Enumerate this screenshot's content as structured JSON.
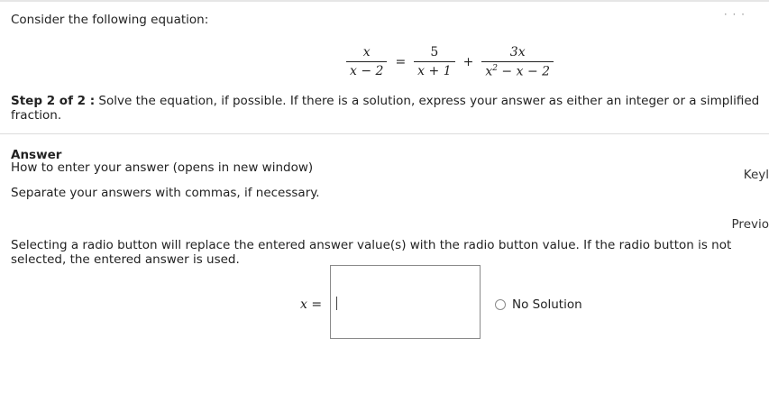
{
  "question": {
    "prompt": "Consider the following equation:",
    "equation": {
      "term1_num": "x",
      "term1_den": "x − 2",
      "equals": "=",
      "term2_num": "5",
      "term2_den": "x + 1",
      "plus": "+",
      "term3_num": "3x",
      "term3_den_base": "x",
      "term3_den_exp": "2",
      "term3_den_rest": " − x − 2"
    },
    "step_label": "Step 2 of 2 :",
    "step_text": " Solve the equation, if possible. If there is a solution, express your answer as either an integer or a simplified fraction."
  },
  "answer_section": {
    "heading": "Answer",
    "how_to_link": "How to enter your answer (opens in new window)",
    "key_link": "Keyl",
    "separate_note": "Separate your answers with commas, if necessary.",
    "previous_link": "Previo",
    "radio_note": "Selecting a radio button will replace the entered answer value(s) with the radio button value. If the radio button is not selected, the entered answer is used.",
    "x_label": "x =",
    "input_value": "",
    "no_solution_label": "No Solution",
    "no_solution_selected": false
  },
  "menu_icon": "more-options-icon"
}
